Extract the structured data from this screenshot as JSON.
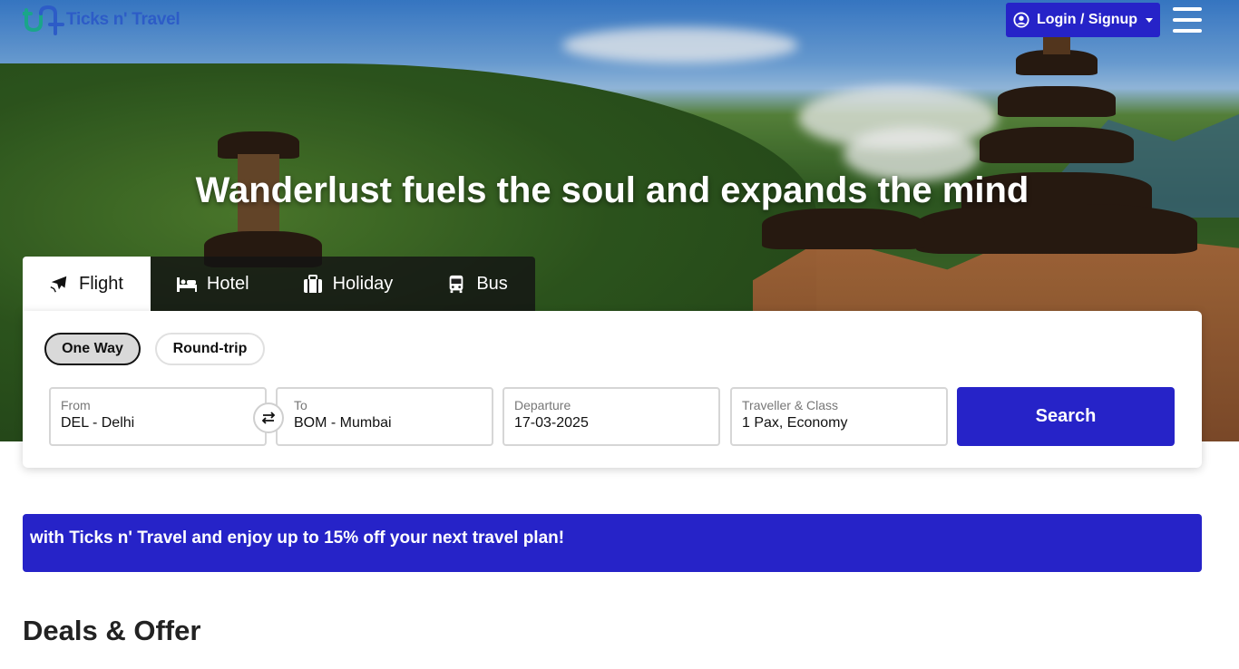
{
  "brand": {
    "name": "Ticks n' Travel",
    "logo_icon": "route-logo-icon",
    "colors": {
      "primary": "#2623c8",
      "logo_teal": "#1aa58a",
      "logo_blue": "#2d5cc7"
    }
  },
  "header": {
    "login_label": "Login / Signup",
    "user_icon": "user-circle-icon",
    "menu_icon": "hamburger-icon"
  },
  "hero": {
    "headline": "Wanderlust fuels the soul and expands the mind"
  },
  "tabs": [
    {
      "label": "Flight",
      "icon": "plane-icon",
      "active": true
    },
    {
      "label": "Hotel",
      "icon": "bed-icon",
      "active": false
    },
    {
      "label": "Holiday",
      "icon": "suitcase-icon",
      "active": false
    },
    {
      "label": "Bus",
      "icon": "bus-icon",
      "active": false
    }
  ],
  "search": {
    "trip_types": [
      {
        "label": "One Way",
        "selected": true
      },
      {
        "label": "Round-trip",
        "selected": false
      }
    ],
    "fields": {
      "from": {
        "label": "From",
        "value": "DEL - Delhi"
      },
      "to": {
        "label": "To",
        "value": "BOM - Mumbai"
      },
      "departure": {
        "label": "Departure",
        "value": "17-03-2025"
      },
      "traveller": {
        "label": "Traveller & Class",
        "value": "1 Pax, Economy"
      }
    },
    "swap_icon": "swap-arrows-icon",
    "submit_label": "Search"
  },
  "promo": {
    "text": "with Ticks n' Travel and enjoy up to 15% off your next travel plan!"
  },
  "deals": {
    "title": "Deals & Offer"
  }
}
